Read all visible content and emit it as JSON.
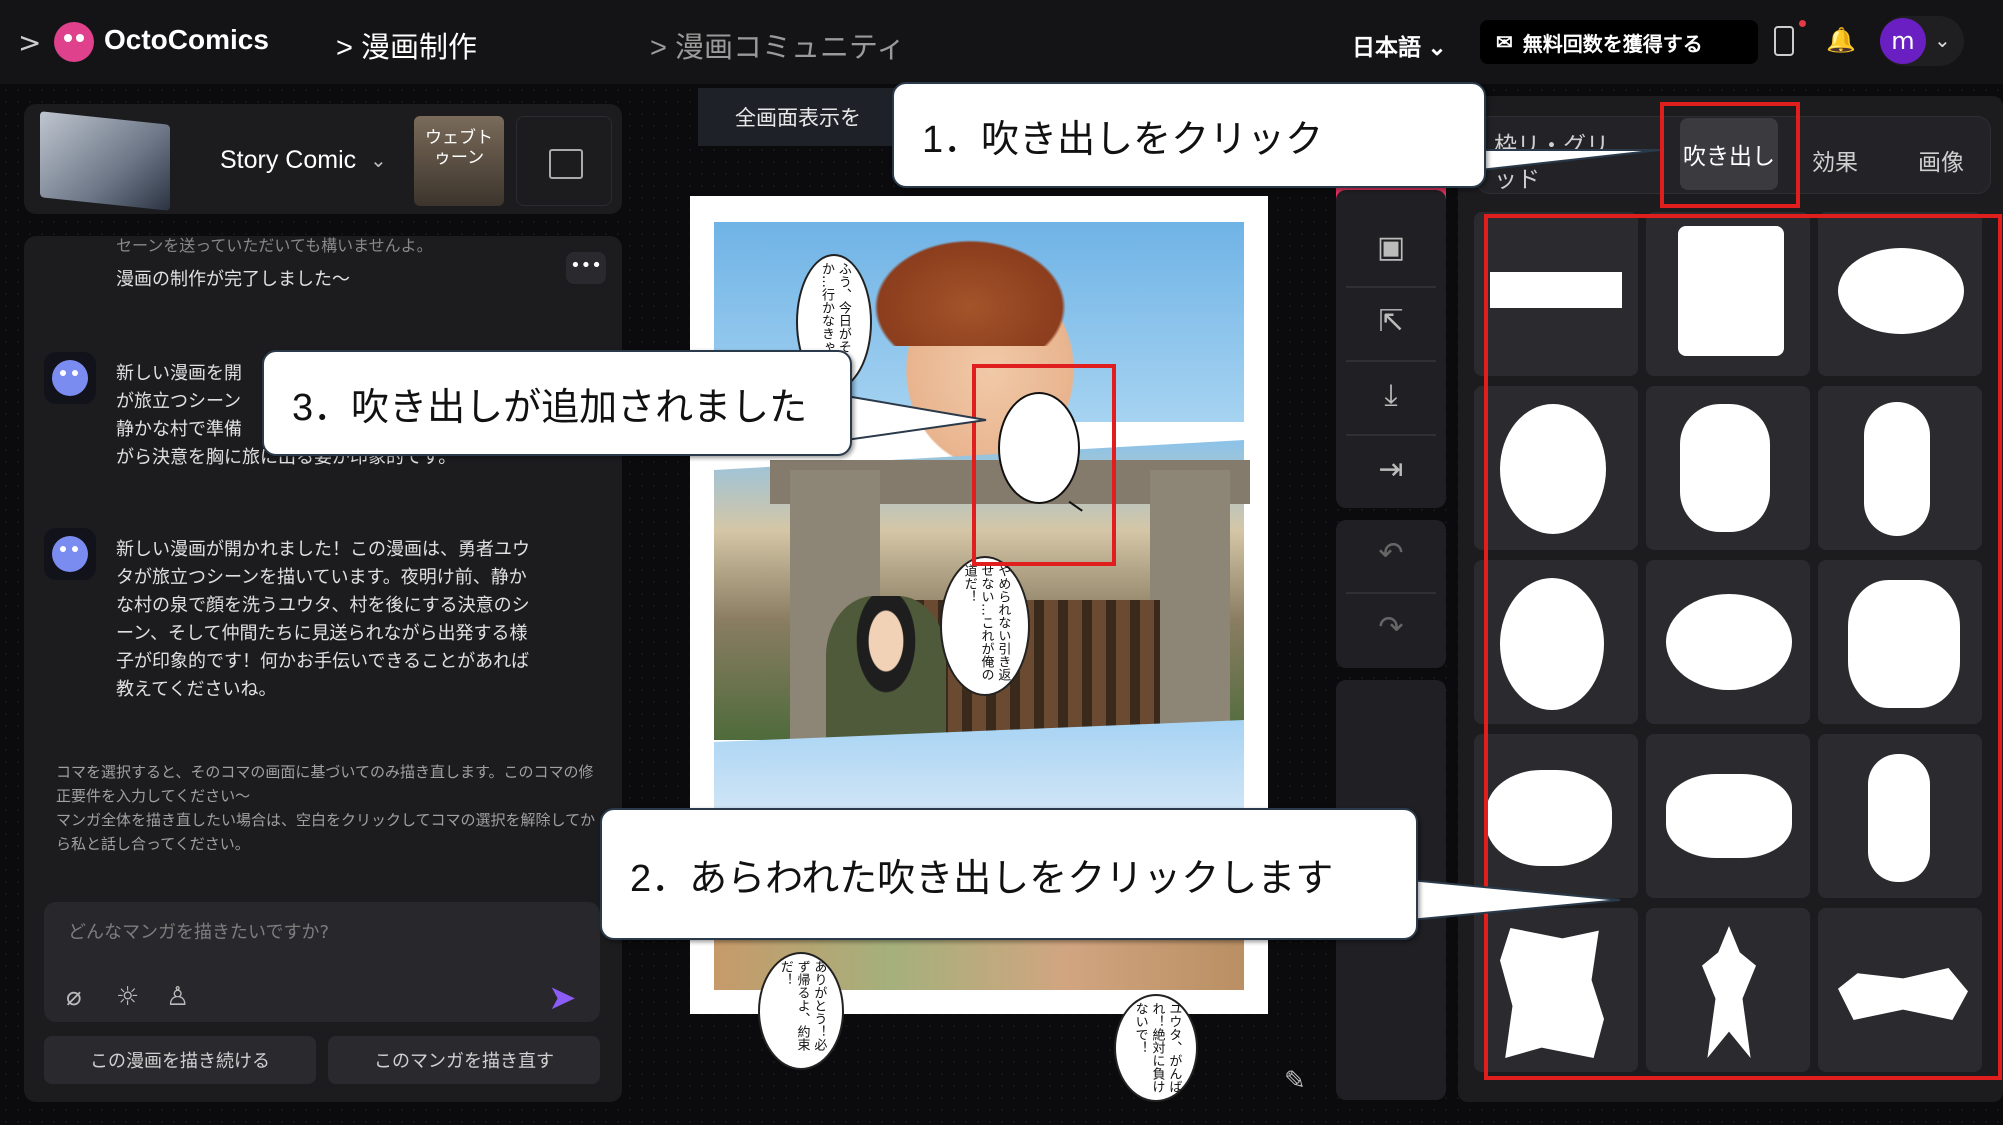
{
  "header": {
    "brand": "OctoComics",
    "breadcrumb_create": "> 漫画制作",
    "breadcrumb_community": "> 漫画コミュニティ",
    "language": "日本語",
    "get_free_button": "無料回数を獲得する",
    "avatar_initial": "m"
  },
  "left_panel": {
    "story_label": "Story Comic",
    "webtoon_label": "ウェブトゥーン",
    "chat": [
      {
        "text": "セーンを送っていただいても構いませんよ。",
        "faded": true
      },
      {
        "text": "漫画の制作が完了しました～"
      },
      {
        "text": "新しい漫画を開かれました！この漫画は、勇者ユウタが旅立つシーンを描いています。夜明け前、静かな村で準備をしながら決意を胸に旅に出る姿が印象的です。"
      },
      {
        "text": "新しい漫画が開かれました！この漫画は、勇者ユウタが旅立つシーンを描いています。夜明け前、静かな村の泉で顔を洗うユウタ、村を後にする決意のシーン、そして仲間たちに見送られながら出発する様子が印象的です！何かお手伝いできることがあれば教えてくださいね。"
      }
    ],
    "msg1_visible": "新しい漫画を開\nが旅立つシーン\n静かな村で準備\nがら決意を胸に旅に出る姿が印象的です。",
    "more_label": "•••",
    "hint": "コマを選択すると、そのコマの画面に基づいてのみ描き直します。このコマの修正要件を入力してください～\nマンガ全体を描き直したい場合は、空白をクリックしてコマの選択を解除してから私と話し合ってください。",
    "input_placeholder": "どんなマンガを描きたいですか?",
    "continue_button": "この漫画を描き続ける",
    "redraw_button": "このマンガを描き直す"
  },
  "canvas": {
    "fullscreen_label": "全画面表示を",
    "bubbles": [
      "ふう、今日がその日か…行かなきゃ！",
      "やめられない引き返せない…これが俺の道だ！",
      "ありがとう！必ず帰るよ、約束だ！",
      "ユウタ、がんばれ！絶対に負けないで！"
    ]
  },
  "right_panel": {
    "tabs": [
      "枠リ・グリッド",
      "吹き出し",
      "効果",
      "画像"
    ],
    "active_tab": "吹き出し"
  },
  "annotations": {
    "step1": "1．吹き出しをクリック",
    "step2": "2．あらわれた吹き出しをクリックします",
    "step3": "3．吹き出しが追加されました",
    "highlight_color": "#e01e1e"
  },
  "colors": {
    "accent": "#e0305b",
    "avatar": "#6a1fc2",
    "send": "#8b5cf6",
    "brand_icon": "#e0418c"
  }
}
